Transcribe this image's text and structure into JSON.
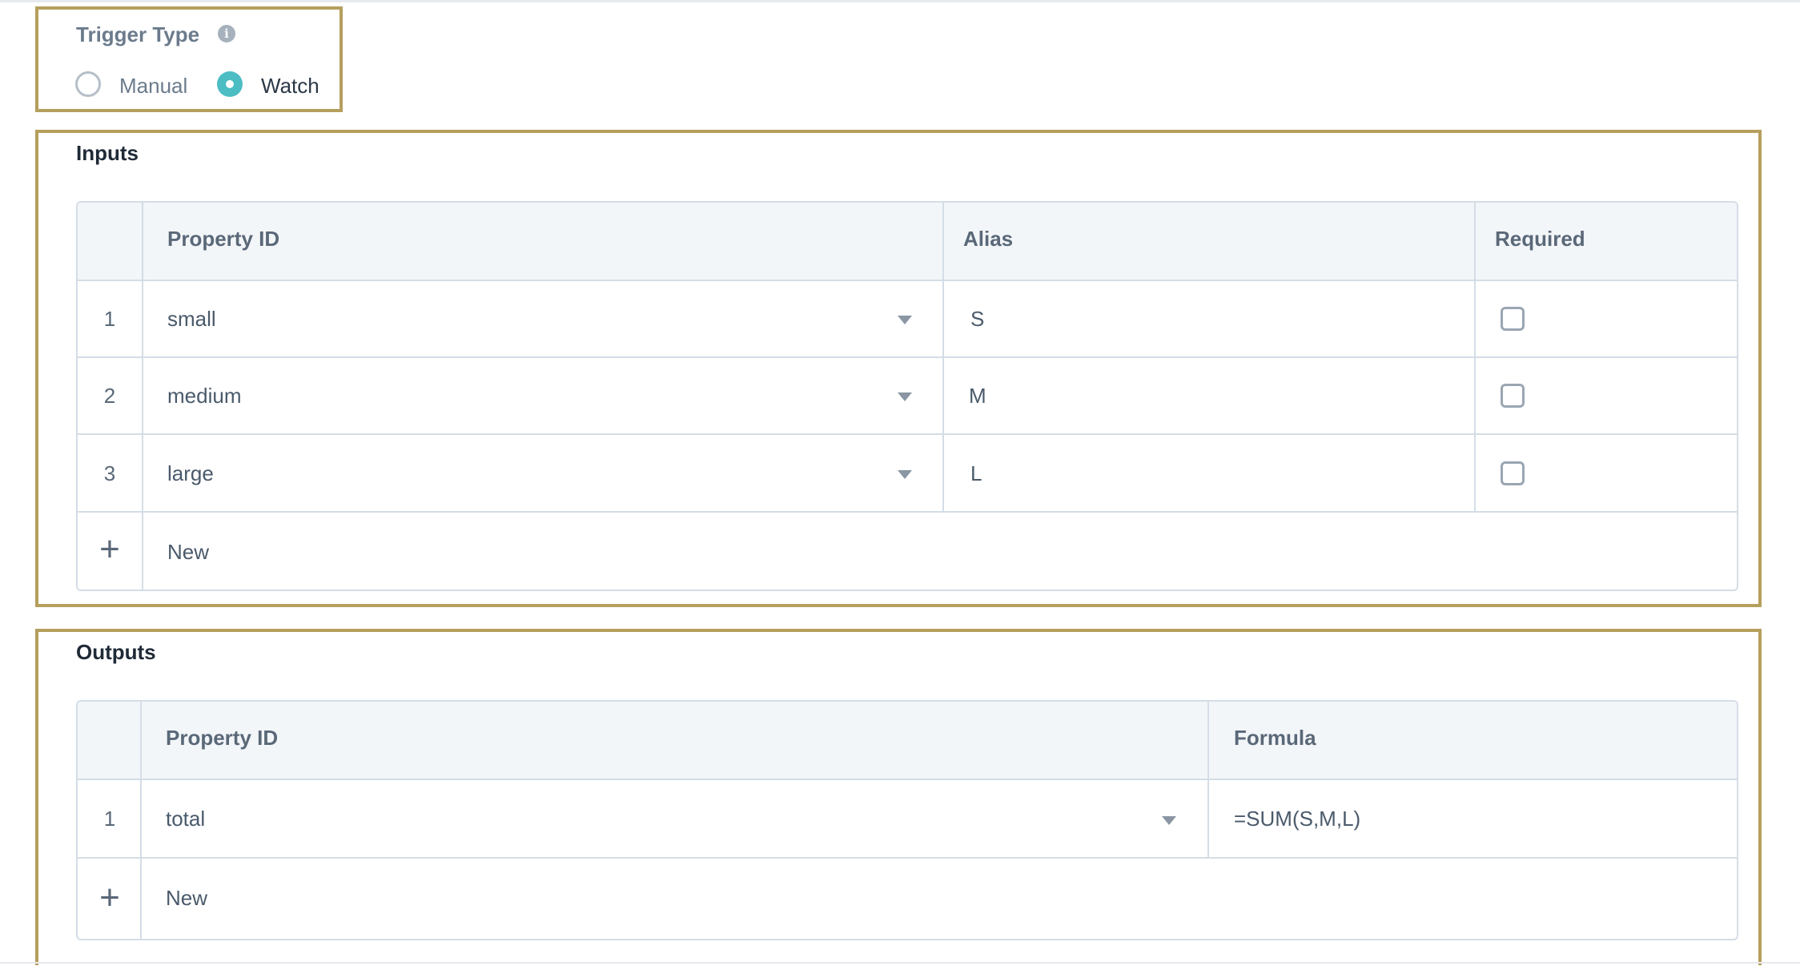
{
  "trigger": {
    "title": "Trigger Type",
    "info_icon": "info-icon",
    "options": [
      {
        "label": "Manual",
        "selected": false
      },
      {
        "label": "Watch",
        "selected": true
      }
    ],
    "accent_color": "#4dbdc4"
  },
  "inputs": {
    "title": "Inputs",
    "columns": [
      "Property ID",
      "Alias",
      "Required"
    ],
    "rows": [
      {
        "num": "1",
        "property_id": "small",
        "alias": "S",
        "required": false
      },
      {
        "num": "2",
        "property_id": "medium",
        "alias": "M",
        "required": false
      },
      {
        "num": "3",
        "property_id": "large",
        "alias": "L",
        "required": false
      }
    ],
    "new_label": "New"
  },
  "outputs": {
    "title": "Outputs",
    "columns": [
      "Property ID",
      "Formula"
    ],
    "rows": [
      {
        "num": "1",
        "property_id": "total",
        "formula": "=SUM(S,M,L)"
      }
    ],
    "new_label": "New"
  },
  "highlight_color": "#b59f5d"
}
